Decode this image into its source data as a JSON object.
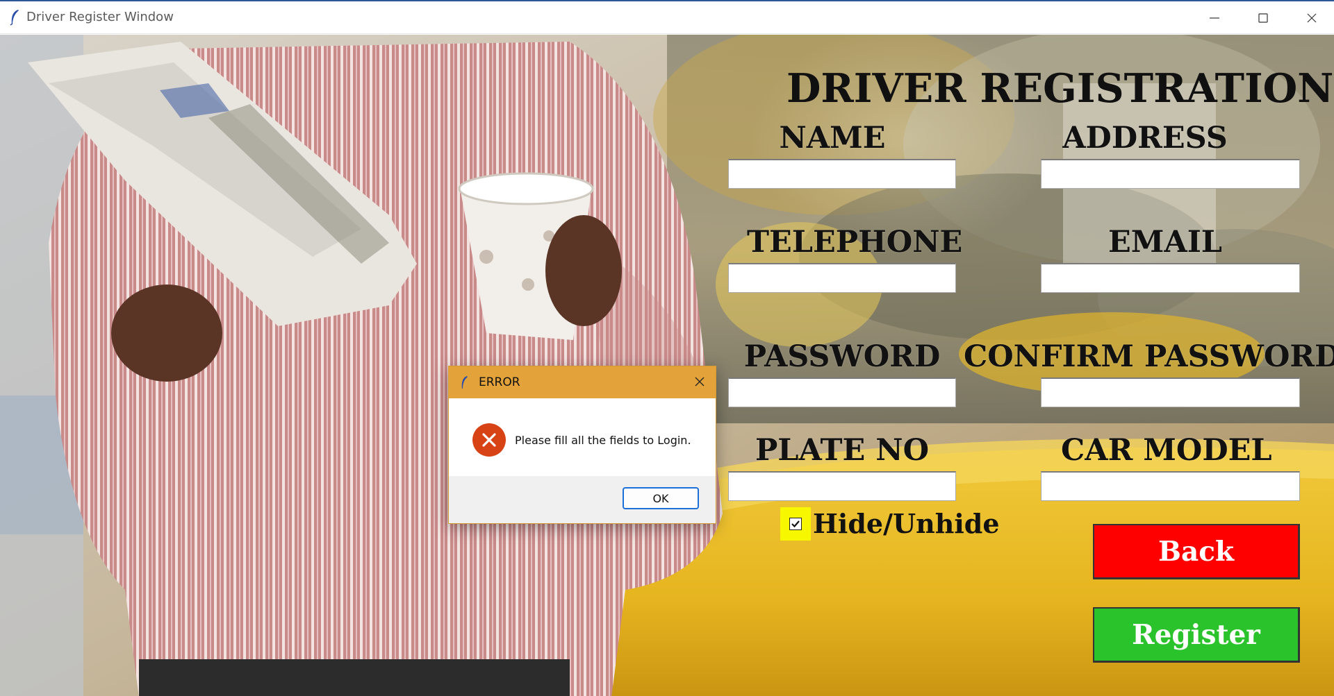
{
  "window": {
    "title": "Driver Register Window",
    "title_icon": "feather-icon",
    "controls": [
      "minimize-icon",
      "maximize-icon",
      "close-icon"
    ]
  },
  "form": {
    "heading": "DRIVER REGISTRATION",
    "fields": {
      "name": {
        "label": "NAME",
        "value": ""
      },
      "address": {
        "label": "ADDRESS",
        "value": ""
      },
      "telephone": {
        "label": "TELEPHONE",
        "value": ""
      },
      "email": {
        "label": "EMAIL",
        "value": ""
      },
      "password": {
        "label": "PASSWORD",
        "value": ""
      },
      "confirm_password": {
        "label": "CONFIRM PASSWORD",
        "value": ""
      },
      "plate_no": {
        "label": "PLATE NO",
        "value": ""
      },
      "car_model": {
        "label": "CAR MODEL",
        "value": ""
      }
    },
    "hide_unhide": {
      "label": "Hide/Unhide",
      "checked": true
    },
    "back_label": "Back",
    "register_label": "Register"
  },
  "dialog": {
    "title": "ERROR",
    "message": "Please fill all the fields to Login.",
    "ok_label": "OK",
    "icon": "error-icon"
  },
  "colors": {
    "back_button": "#ff0000",
    "register_button": "#2bc32b",
    "checkbox_bg": "#f7f700",
    "dialog_title_bar": "#e3a33a",
    "error_icon": "#d84315"
  }
}
